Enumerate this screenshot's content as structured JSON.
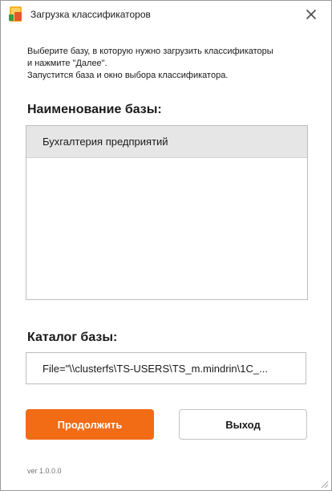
{
  "window": {
    "title": "Загрузка классификаторов",
    "app_icon": "classifier-app-icon",
    "close_icon": "close-icon"
  },
  "instructions": {
    "line1": "Выберите базу, в которую нужно загрузить классификаторы",
    "line2": "и нажмите \"Далее\".",
    "line3": "Запустится база и окно выбора классификатора."
  },
  "db_list": {
    "label": "Наименование базы:",
    "items": [
      {
        "name": "Бухгалтерия предприятий",
        "selected": true
      }
    ]
  },
  "catalog": {
    "label": "Каталог базы:",
    "value": "File=\"\\\\clusterfs\\TS-USERS\\TS_m.mindrin\\1C_..."
  },
  "buttons": {
    "continue_label": "Продолжить",
    "exit_label": "Выход"
  },
  "footer": {
    "version": "ver 1.0.0.0"
  },
  "colors": {
    "accent": "#f26b15",
    "selected_row": "#e6e6e6",
    "border": "#bdbdbd"
  }
}
